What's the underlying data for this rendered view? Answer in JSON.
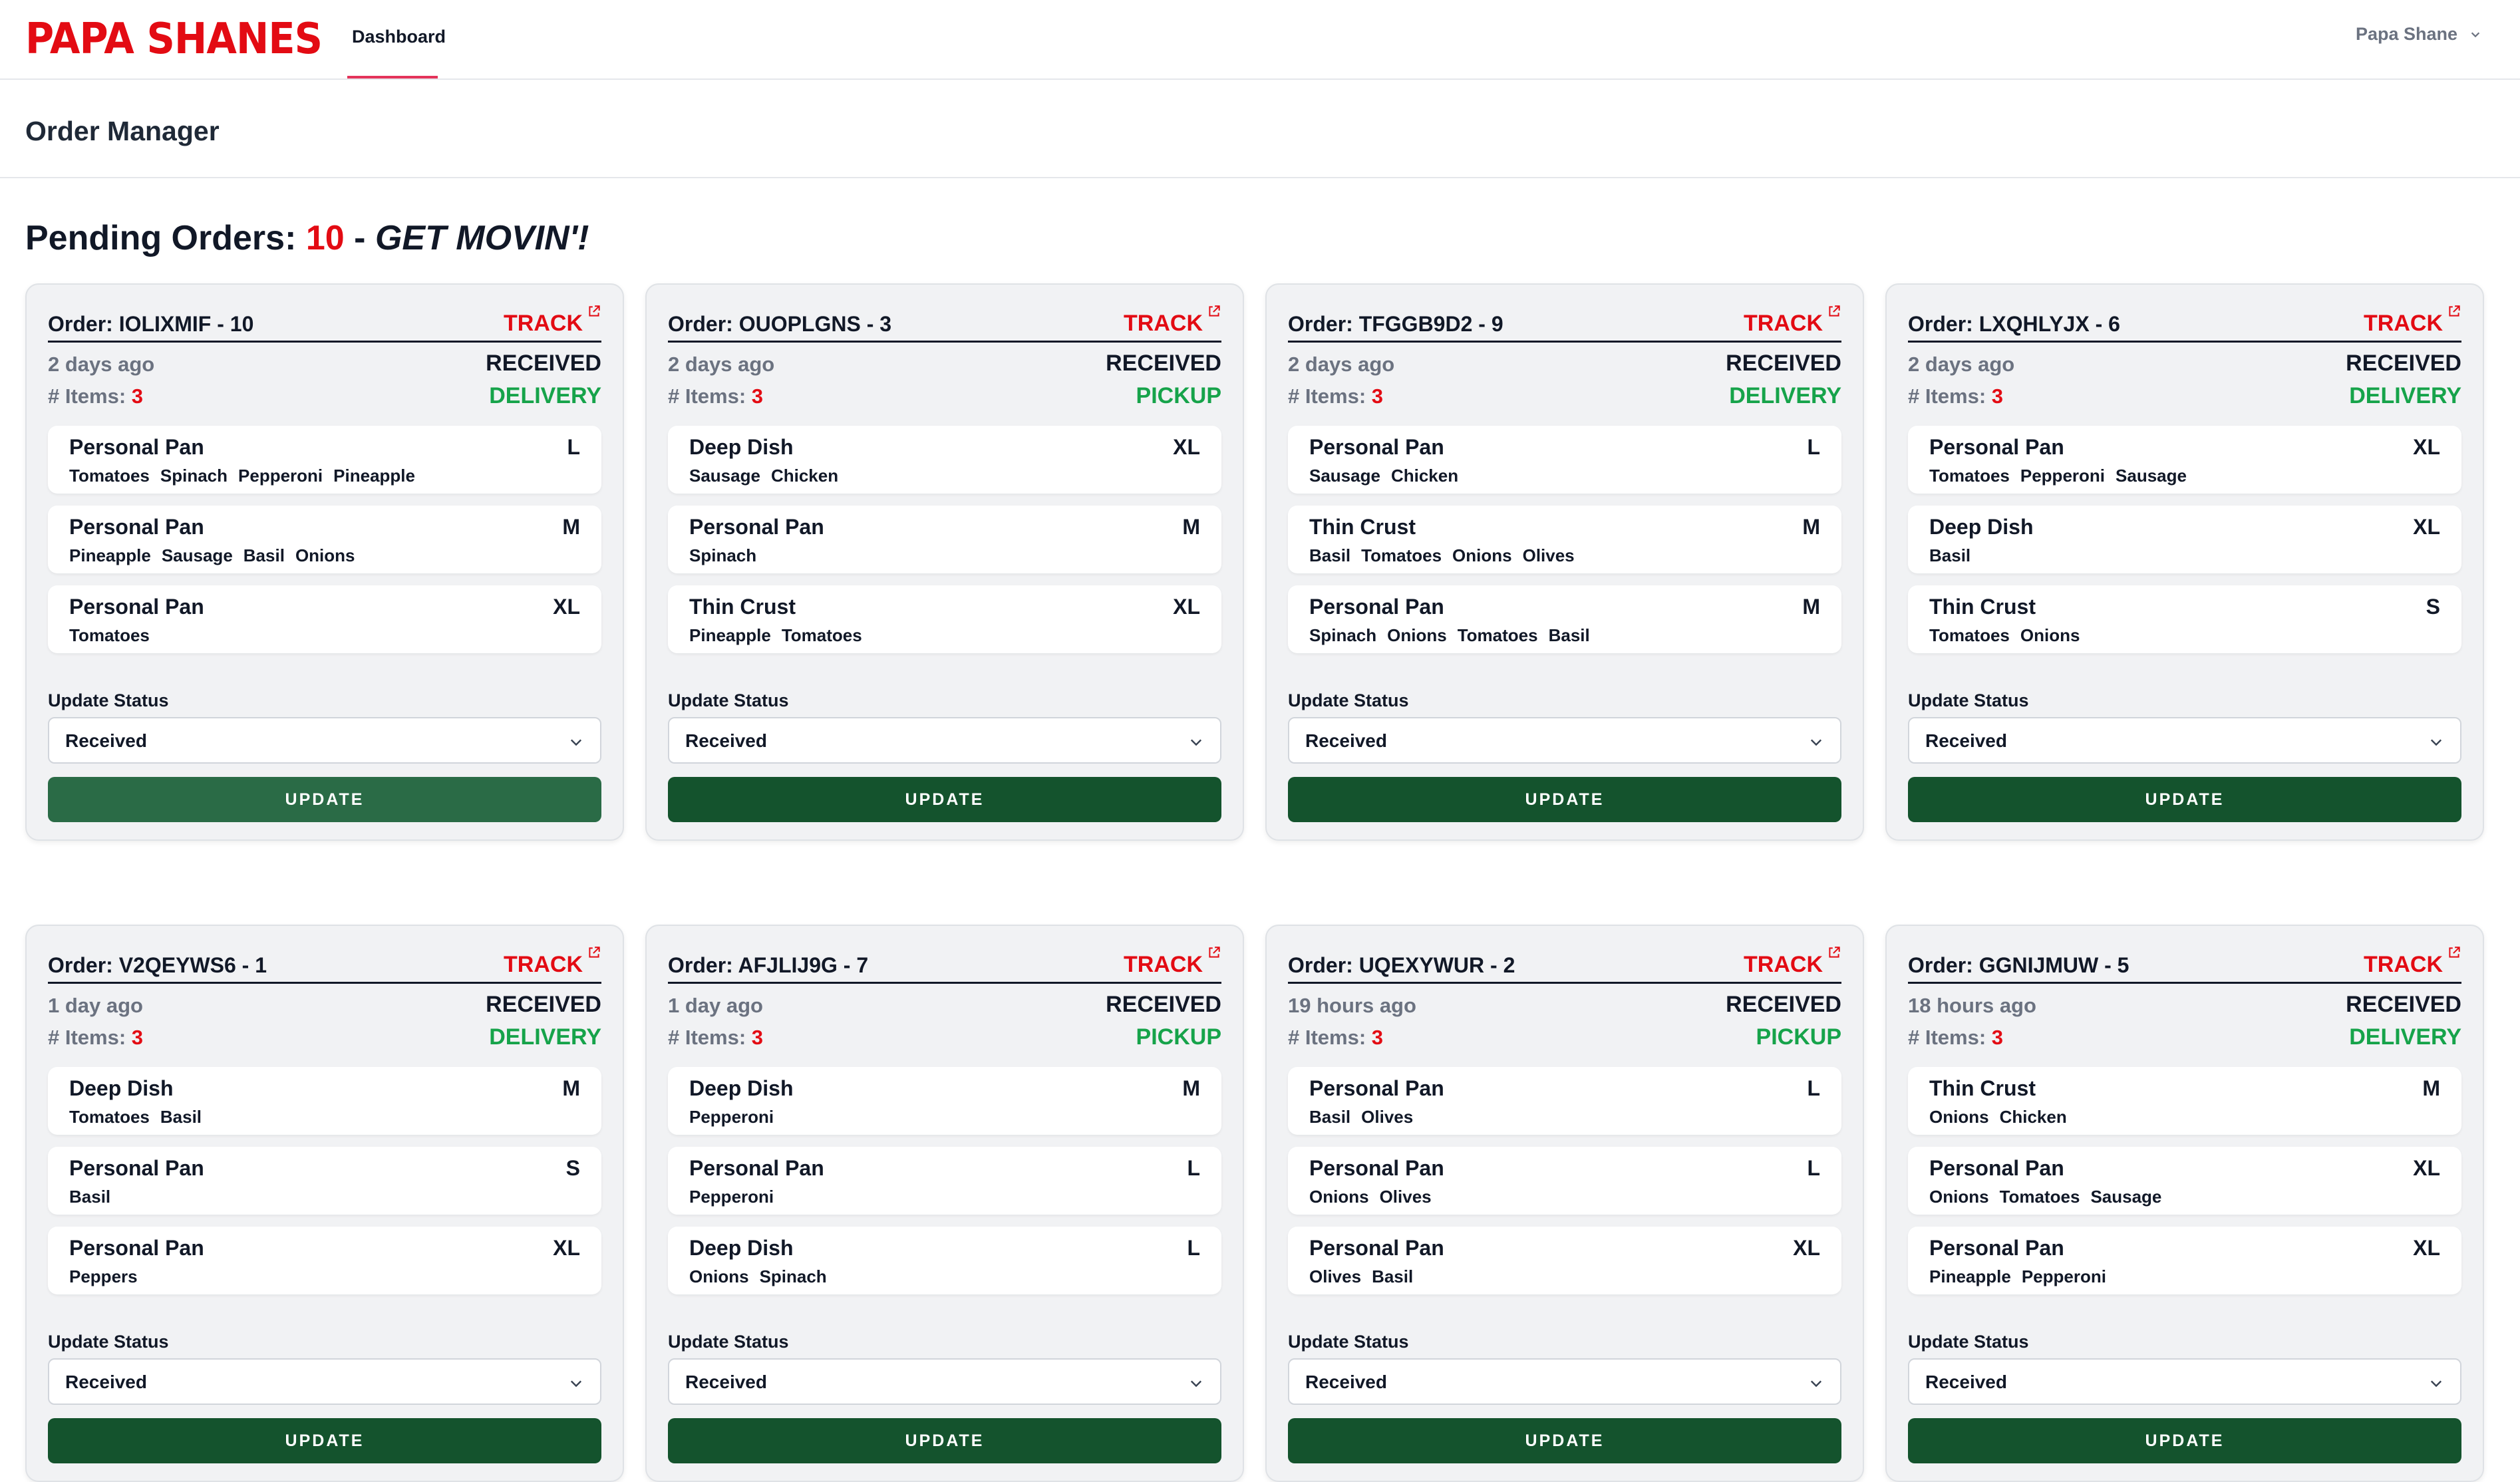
{
  "brand": {
    "logo": "PAPA SHANES"
  },
  "nav": {
    "tab": "Dashboard"
  },
  "user": {
    "name": "Papa Shane"
  },
  "page": {
    "title": "Order Manager"
  },
  "pending": {
    "label": "Pending Orders:",
    "count": "10",
    "dash": "-",
    "message": "GET MOVIN'!"
  },
  "labels": {
    "track": "TRACK",
    "items_prefix": "# Items:",
    "update_status": "Update Status",
    "update_button": "UPDATE"
  },
  "colors": {
    "brand_red": "#e30b13",
    "green": "#16a34a",
    "button_green": "#14532d"
  },
  "orders": [
    {
      "id": "Order: IOLIXMIF - 10",
      "time": "2 days ago",
      "status": "RECEIVED",
      "mode": "DELIVERY",
      "count": "3",
      "select": "Received",
      "items": [
        {
          "name": "Personal Pan",
          "size": "L",
          "toppings": [
            "Tomatoes",
            "Spinach",
            "Pepperoni",
            "Pineapple"
          ]
        },
        {
          "name": "Personal Pan",
          "size": "M",
          "toppings": [
            "Pineapple",
            "Sausage",
            "Basil",
            "Onions"
          ]
        },
        {
          "name": "Personal Pan",
          "size": "XL",
          "toppings": [
            "Tomatoes"
          ]
        }
      ]
    },
    {
      "id": "Order: OUOPLGNS - 3",
      "time": "2 days ago",
      "status": "RECEIVED",
      "mode": "PICKUP",
      "count": "3",
      "select": "Received",
      "items": [
        {
          "name": "Deep Dish",
          "size": "XL",
          "toppings": [
            "Sausage",
            "Chicken"
          ]
        },
        {
          "name": "Personal Pan",
          "size": "M",
          "toppings": [
            "Spinach"
          ]
        },
        {
          "name": "Thin Crust",
          "size": "XL",
          "toppings": [
            "Pineapple",
            "Tomatoes"
          ]
        }
      ]
    },
    {
      "id": "Order: TFGGB9D2 - 9",
      "time": "2 days ago",
      "status": "RECEIVED",
      "mode": "DELIVERY",
      "count": "3",
      "select": "Received",
      "items": [
        {
          "name": "Personal Pan",
          "size": "L",
          "toppings": [
            "Sausage",
            "Chicken"
          ]
        },
        {
          "name": "Thin Crust",
          "size": "M",
          "toppings": [
            "Basil",
            "Tomatoes",
            "Onions",
            "Olives"
          ]
        },
        {
          "name": "Personal Pan",
          "size": "M",
          "toppings": [
            "Spinach",
            "Onions",
            "Tomatoes",
            "Basil"
          ]
        }
      ]
    },
    {
      "id": "Order: LXQHLYJX - 6",
      "time": "2 days ago",
      "status": "RECEIVED",
      "mode": "DELIVERY",
      "count": "3",
      "select": "Received",
      "items": [
        {
          "name": "Personal Pan",
          "size": "XL",
          "toppings": [
            "Tomatoes",
            "Pepperoni",
            "Sausage"
          ]
        },
        {
          "name": "Deep Dish",
          "size": "XL",
          "toppings": [
            "Basil"
          ]
        },
        {
          "name": "Thin Crust",
          "size": "S",
          "toppings": [
            "Tomatoes",
            "Onions"
          ]
        }
      ]
    },
    {
      "id": "Order: V2QEYWS6 - 1",
      "time": "1 day ago",
      "status": "RECEIVED",
      "mode": "DELIVERY",
      "count": "3",
      "select": "Received",
      "items": [
        {
          "name": "Deep Dish",
          "size": "M",
          "toppings": [
            "Tomatoes",
            "Basil"
          ]
        },
        {
          "name": "Personal Pan",
          "size": "S",
          "toppings": [
            "Basil"
          ]
        },
        {
          "name": "Personal Pan",
          "size": "XL",
          "toppings": [
            "Peppers"
          ]
        }
      ]
    },
    {
      "id": "Order: AFJLIJ9G - 7",
      "time": "1 day ago",
      "status": "RECEIVED",
      "mode": "PICKUP",
      "count": "3",
      "select": "Received",
      "items": [
        {
          "name": "Deep Dish",
          "size": "M",
          "toppings": [
            "Pepperoni"
          ]
        },
        {
          "name": "Personal Pan",
          "size": "L",
          "toppings": [
            "Pepperoni"
          ]
        },
        {
          "name": "Deep Dish",
          "size": "L",
          "toppings": [
            "Onions",
            "Spinach"
          ]
        }
      ]
    },
    {
      "id": "Order: UQEXYWUR - 2",
      "time": "19 hours ago",
      "status": "RECEIVED",
      "mode": "PICKUP",
      "count": "3",
      "select": "Received",
      "items": [
        {
          "name": "Personal Pan",
          "size": "L",
          "toppings": [
            "Basil",
            "Olives"
          ]
        },
        {
          "name": "Personal Pan",
          "size": "L",
          "toppings": [
            "Onions",
            "Olives"
          ]
        },
        {
          "name": "Personal Pan",
          "size": "XL",
          "toppings": [
            "Olives",
            "Basil"
          ]
        }
      ]
    },
    {
      "id": "Order: GGNIJMUW - 5",
      "time": "18 hours ago",
      "status": "RECEIVED",
      "mode": "DELIVERY",
      "count": "3",
      "select": "Received",
      "items": [
        {
          "name": "Thin Crust",
          "size": "M",
          "toppings": [
            "Onions",
            "Chicken"
          ]
        },
        {
          "name": "Personal Pan",
          "size": "XL",
          "toppings": [
            "Onions",
            "Tomatoes",
            "Sausage"
          ]
        },
        {
          "name": "Personal Pan",
          "size": "XL",
          "toppings": [
            "Pineapple",
            "Pepperoni"
          ]
        }
      ]
    }
  ]
}
